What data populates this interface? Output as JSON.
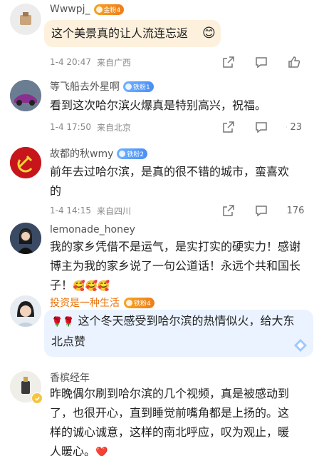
{
  "comments": [
    {
      "username": "Wwwpj_",
      "badge": "金粉4",
      "text": "这个美景真的让人流连忘返",
      "emoji": "😊",
      "time": "1-4 20:47",
      "location": "来自广西",
      "likes": ""
    },
    {
      "username": "等飞船去外星啊",
      "badge": "铁粉1",
      "text": "看到这次哈尔滨火爆真是特别高兴，祝福。",
      "time": "1-4 17:50",
      "location": "来自北京",
      "likes": "23"
    },
    {
      "username": "故都的秋wmy",
      "badge": "铁粉2",
      "text": "前年去过哈尔滨，是真的很不错的城市，蛮喜欢的",
      "time": "1-4 14:15",
      "location": "来自四川",
      "likes": "176"
    },
    {
      "username": "lemonade_honey",
      "text": "我的家乡凭借不是运气，是实打实的硬实力！感谢博主为我的家乡说了一句公道话！永远个共和国长子！",
      "emoji": "🥰🥰🥰"
    },
    {
      "username": "投资是一种生活",
      "badge": "铁粉4",
      "roses": "🌹🌹",
      "text": "这个冬天感受到哈尔滨的热情似火，给大东北点赞"
    },
    {
      "username": "香槟经年",
      "text": "昨晚偶尔刷到哈尔滨的几个视频，真是被感动到了，也很开心，直到睡觉前嘴角都是上扬的。这样的诚心诚意，这样的南北呼应，叹为观止，暖人暖心。",
      "emoji": "❤️"
    }
  ],
  "colors": {
    "bubble_gold": "#fdf1dd",
    "bubble_blue": "#eaf3ff",
    "badge_orange": "#f39a1f",
    "badge_blue": "#5a9cf8",
    "username_orange": "#e8720c"
  }
}
